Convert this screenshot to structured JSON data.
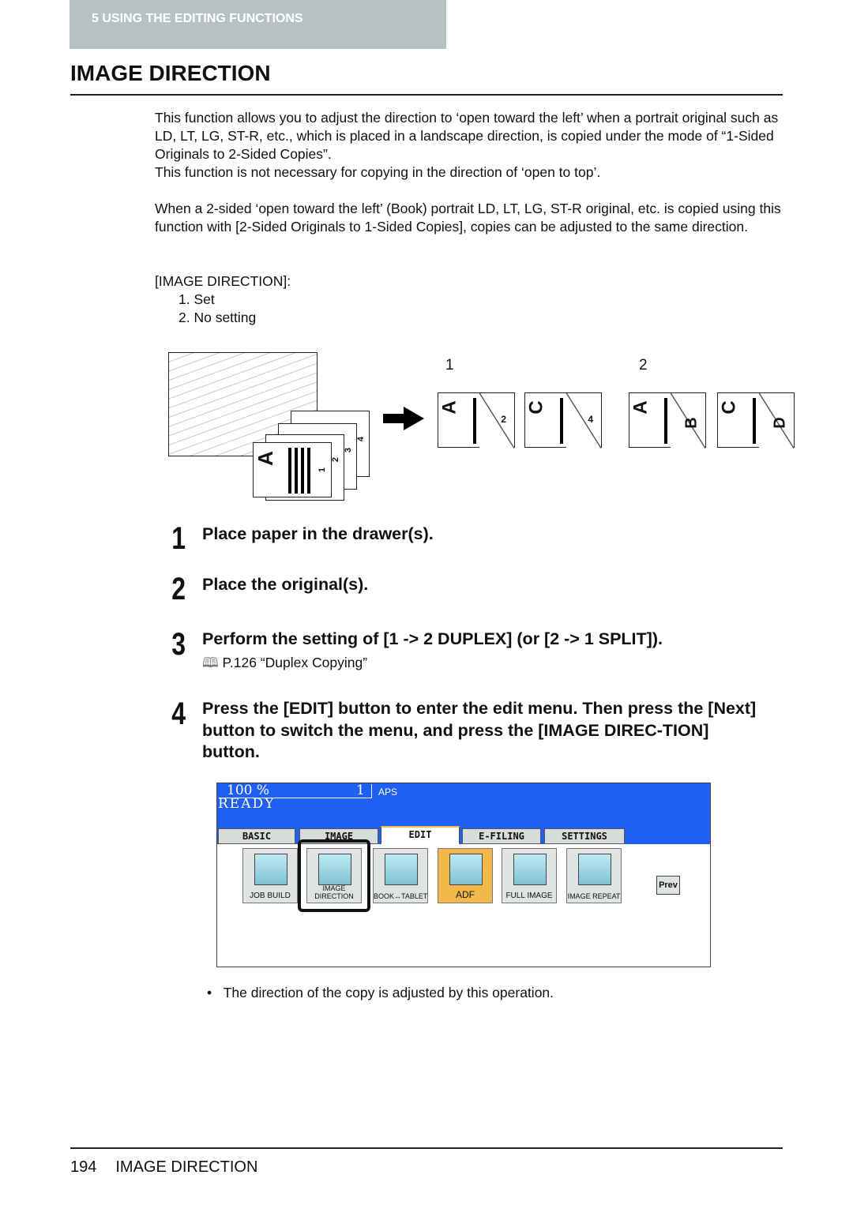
{
  "header": {
    "chapter": "5   USING THE EDITING FUNCTIONS",
    "title": "IMAGE DIRECTION"
  },
  "intro": {
    "p1": "This function allows you to adjust the direction to ‘open toward the left’ when a portrait original such as LD, LT, LG, ST-R, etc., which is placed in a landscape direction, is copied under the mode of “1-Sided Originals to 2-Sided Copies”.",
    "p2": "This function is not necessary for copying in the direction of ‘open to top’.",
    "p3": "When a 2-sided ‘open toward the left’ (Book) portrait LD, LT, LG, ST-R original, etc. is copied using this function with [2-Sided Originals to 1-Sided Copies], copies can be adjusted to the same direction.",
    "options_label": "[IMAGE DIRECTION]:",
    "options": [
      "1.   Set",
      "2.   No setting"
    ]
  },
  "figure": {
    "label1": "1",
    "label2": "2",
    "stack_letter": "A",
    "stack_nums": [
      "1",
      "2",
      "3",
      "4"
    ],
    "pages": [
      {
        "letter": "A",
        "back": "",
        "num": "2"
      },
      {
        "letter": "C",
        "back": "",
        "num": "4"
      },
      {
        "letter": "A",
        "back": "B",
        "num": ""
      },
      {
        "letter": "C",
        "back": "D",
        "num": ""
      }
    ]
  },
  "steps": [
    {
      "num": "1",
      "text": "Place paper in the drawer(s)."
    },
    {
      "num": "2",
      "text": "Place the original(s)."
    },
    {
      "num": "3",
      "text": "Perform the setting of [1 -> 2 DUPLEX] (or [2 -> 1 SPLIT]).",
      "ref": "P.126 “Duplex Copying”"
    },
    {
      "num": "4",
      "text": "Press the [EDIT] button to enter the edit menu. Then press the [Next] button to switch the menu, and press the [IMAGE DIREC-TION] button."
    }
  ],
  "screen": {
    "zoom": "100  %",
    "count": "1",
    "paper": "APS",
    "status": "READY",
    "tabs": [
      "BASIC",
      "IMAGE",
      "EDIT",
      "E-FILING",
      "SETTINGS"
    ],
    "buttons": [
      "JOB BUILD",
      "IMAGE DIRECTION",
      "BOOK↔TABLET",
      "ADF",
      "FULL IMAGE",
      "IMAGE REPEAT"
    ],
    "prev": "Prev",
    "colors": {
      "blue": "#1f5ff2",
      "adf": "#f2b84a"
    }
  },
  "note": "The direction of the copy is adjusted by this operation.",
  "footer": {
    "page": "194",
    "title": "IMAGE DIRECTION"
  }
}
